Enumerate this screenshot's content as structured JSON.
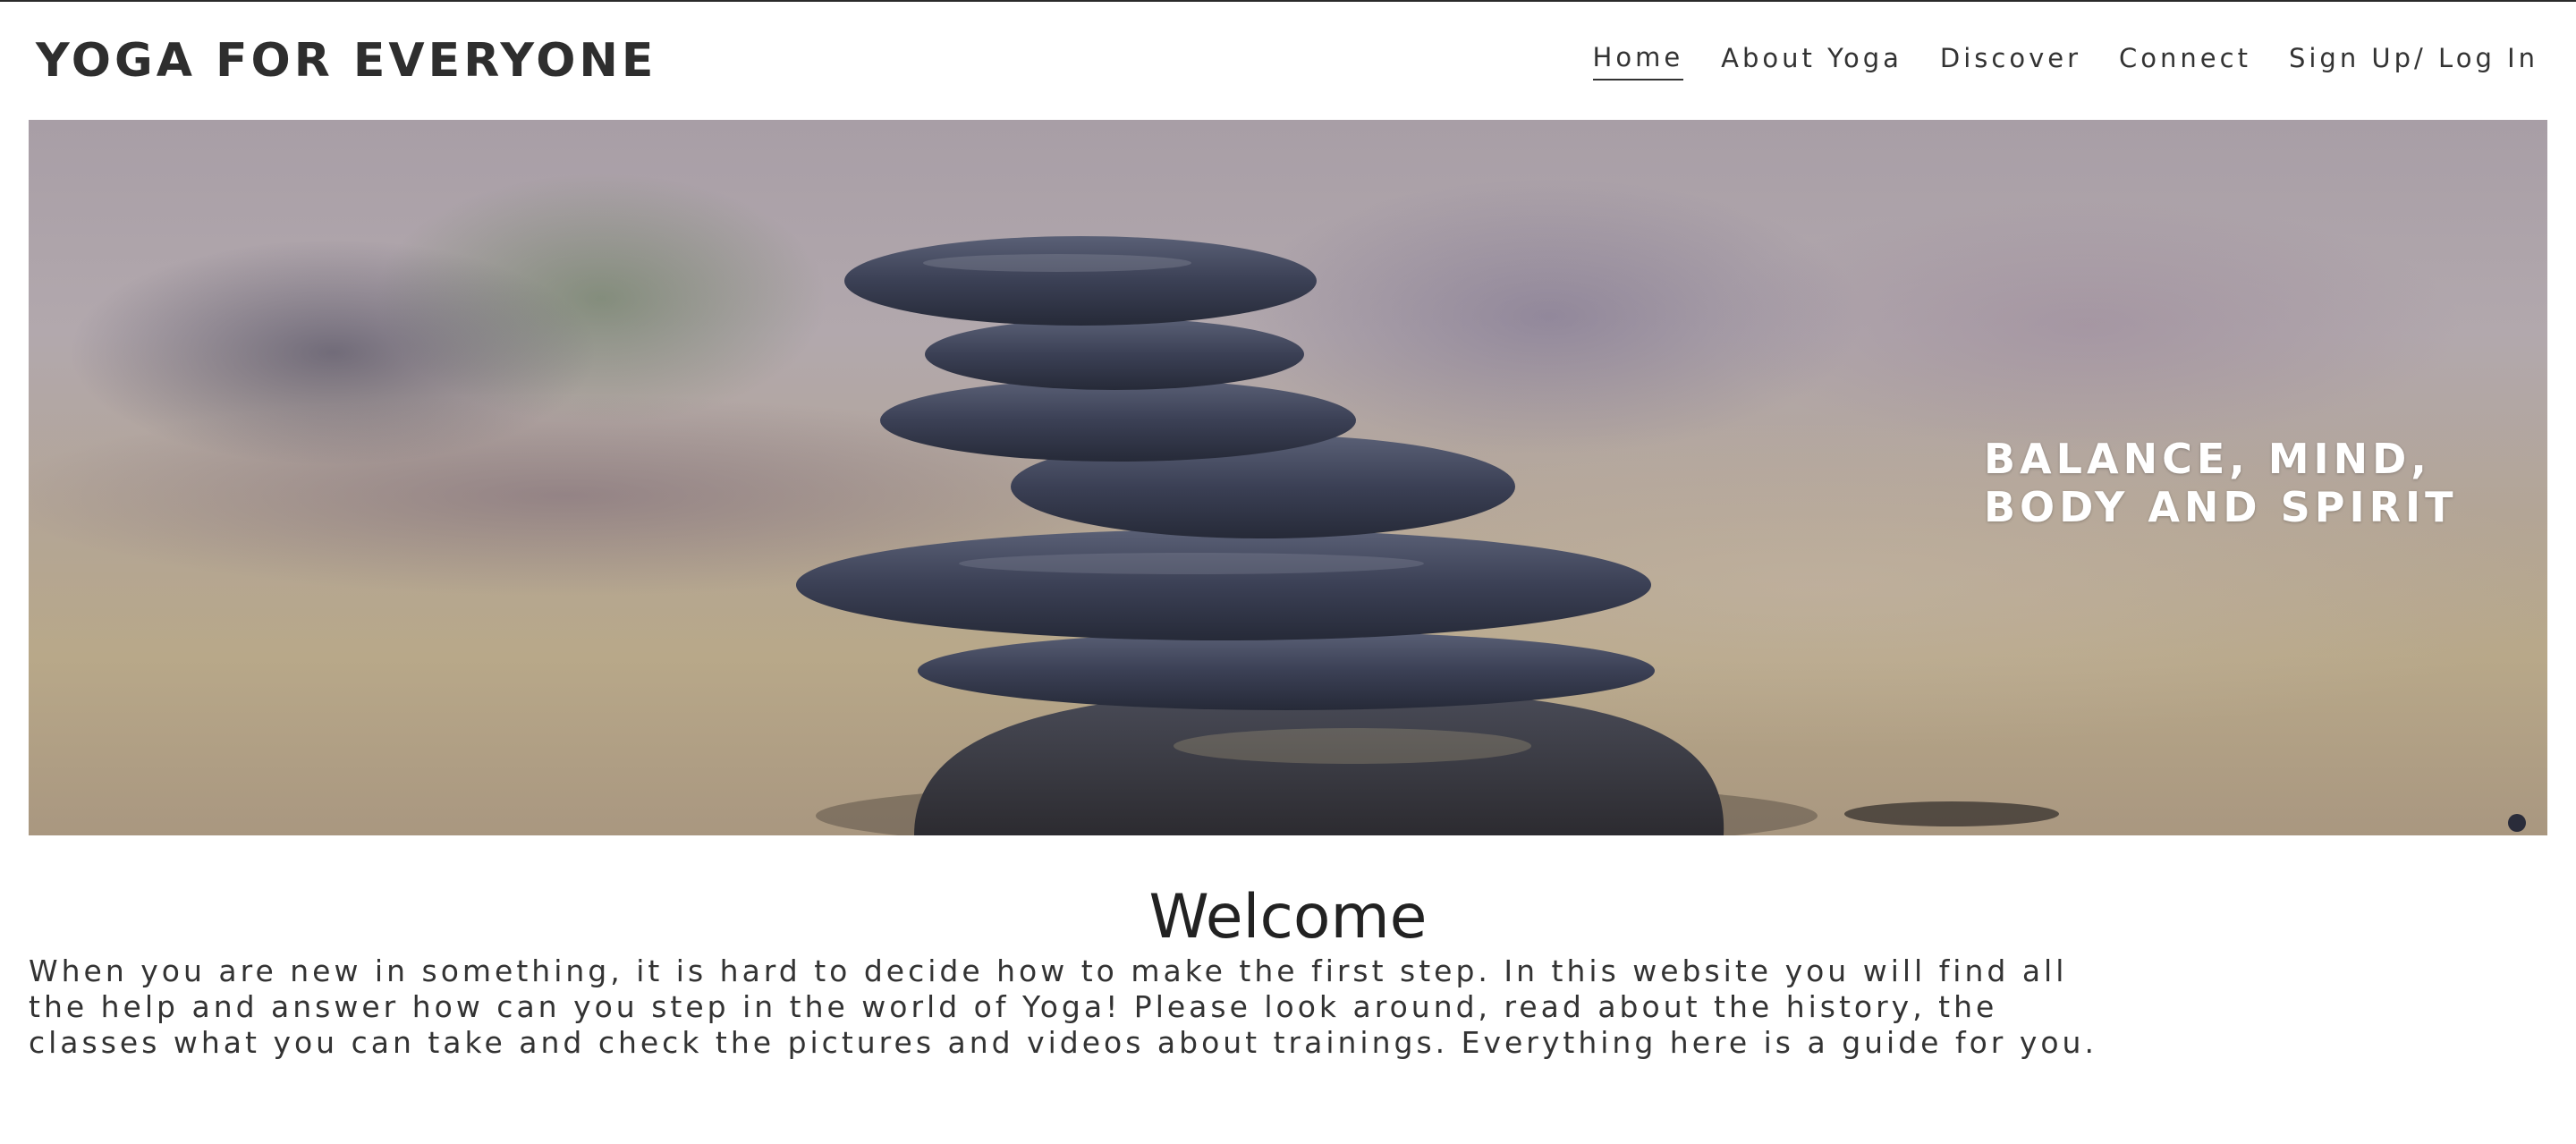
{
  "header": {
    "site_title": "YOGA FOR EVERYONE",
    "nav": [
      {
        "label": "Home",
        "active": true
      },
      {
        "label": "About Yoga",
        "active": false
      },
      {
        "label": "Discover",
        "active": false
      },
      {
        "label": "Connect",
        "active": false
      },
      {
        "label": "Sign Up/ Log In",
        "active": false
      }
    ]
  },
  "hero": {
    "image": "stacked-stones-photo",
    "caption_line1": "BALANCE, MIND,",
    "caption_line2": "BODY AND SPIRIT"
  },
  "welcome": {
    "heading": "Welcome",
    "body": "When you are new in something, it is hard to decide how to make the first step. In this website you will find all the help and answer how can you step in the world of Yoga! Please look around, read about the history, the classes what you can take and check the pictures and videos about trainings. Everything here is a guide for you."
  },
  "colors": {
    "text": "#222222",
    "nav_text": "#333333",
    "caption": "#ffffff",
    "stone": "#3a3f52"
  }
}
